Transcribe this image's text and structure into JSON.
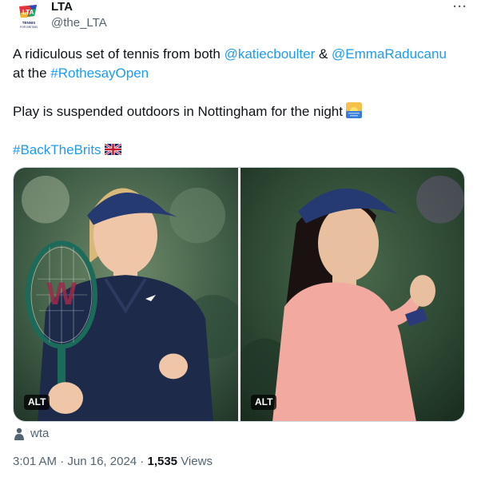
{
  "author": {
    "name": "LTA",
    "handle": "@the_LTA",
    "logo_text": "LTA",
    "logo_subtext": "TENNIS FOR BRITAIN"
  },
  "more_label": "···",
  "tweet": {
    "line1_prefix": "A ridiculous set of tennis from both ",
    "mention1": "@katiecboulter",
    "line1_mid": " & ",
    "mention2": "@EmmaRaducanu",
    "line2_prefix": "at the ",
    "hashtag1": "#RothesayOpen",
    "line3": "Play is suspended outdoors in Nottingham for the night",
    "hashtag2": "#BackTheBrits"
  },
  "media": [
    {
      "alt_label": "ALT",
      "subject": "player in navy top and visor holding racket"
    },
    {
      "alt_label": "ALT",
      "subject": "player in pink top and visor clenching fist"
    }
  ],
  "tagged_user": "wta",
  "meta": {
    "time": "3:01 AM",
    "separator": " · ",
    "date": "Jun 16, 2024",
    "views_count": "1,535",
    "views_label": " Views"
  },
  "icons": {
    "sunrise": "sunrise-emoji-icon",
    "flag": "uk-flag-icon",
    "person": "person-icon"
  },
  "colors": {
    "link": "#1d9bf0",
    "text": "#0f1419",
    "secondary": "#536471"
  }
}
